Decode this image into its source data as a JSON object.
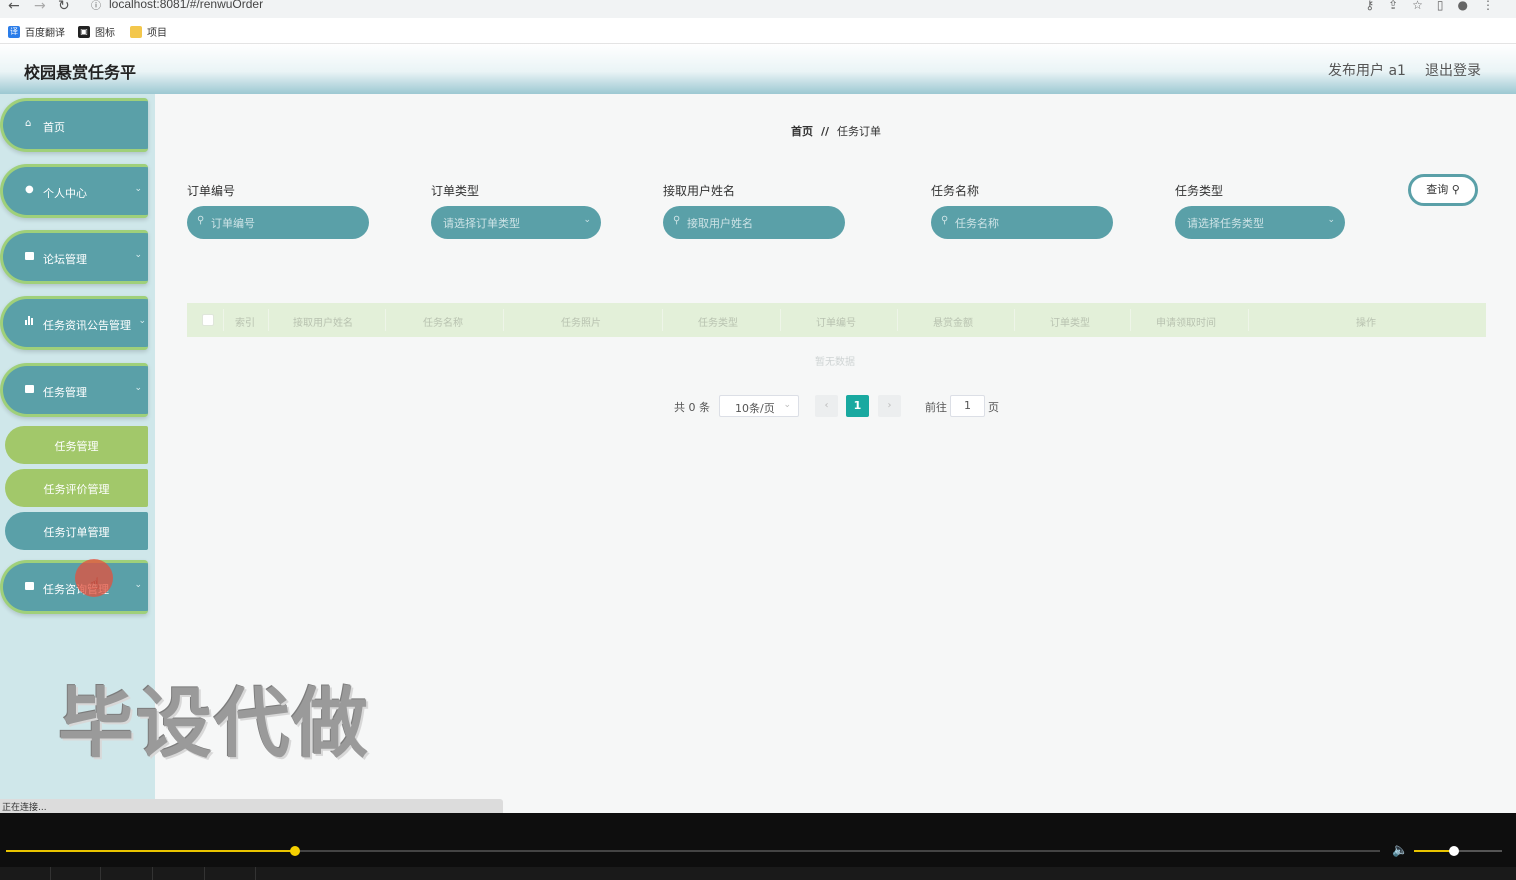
{
  "browser": {
    "url": "localhost:8081/#/renwuOrder",
    "bookmarks": [
      {
        "label": "百度翻译",
        "icon": "translate-icon"
      },
      {
        "label": "图标",
        "icon": "image-icon"
      },
      {
        "label": "项目",
        "icon": "folder-icon"
      }
    ],
    "status_text": "正在连接..."
  },
  "header": {
    "title": "校园悬赏任务平",
    "user_label": "发布用户 a1",
    "logout_label": "退出登录"
  },
  "sidebar": {
    "items": [
      {
        "label": "首页",
        "icon": "home-icon"
      },
      {
        "label": "个人中心",
        "icon": "user-icon"
      },
      {
        "label": "论坛管理",
        "icon": "forum-icon"
      },
      {
        "label": "任务资讯公告管理",
        "icon": "chart-icon"
      },
      {
        "label": "任务管理",
        "icon": "briefcase-icon"
      },
      {
        "label": "任务咨询管理",
        "icon": "chat-icon"
      }
    ],
    "sub_items": [
      {
        "label": "任务管理"
      },
      {
        "label": "任务评价管理"
      },
      {
        "label": "任务订单管理"
      }
    ]
  },
  "breadcrumb": {
    "home": "首页",
    "separator": "//",
    "current": "任务订单"
  },
  "search": {
    "fields": [
      {
        "label": "订单编号",
        "placeholder": "订单编号"
      },
      {
        "label": "订单类型",
        "placeholder": "请选择订单类型"
      },
      {
        "label": "接取用户姓名",
        "placeholder": "接取用户姓名"
      },
      {
        "label": "任务名称",
        "placeholder": "任务名称"
      },
      {
        "label": "任务类型",
        "placeholder": "请选择任务类型"
      }
    ],
    "query_label": "查询"
  },
  "table": {
    "columns": [
      "索引",
      "接取用户姓名",
      "任务名称",
      "任务照片",
      "任务类型",
      "订单编号",
      "悬赏金额",
      "订单类型",
      "申请领取时间",
      "操作"
    ],
    "empty_text": "暂无数据"
  },
  "pagination": {
    "total_text": "共 0 条",
    "page_size": "10条/页",
    "current_page": "1",
    "goto_label": "前往",
    "goto_value": "1",
    "page_unit": "页",
    "prev_icon": "‹",
    "next_icon": "›"
  },
  "watermark": "毕设代做",
  "player": {
    "progress": 0.21,
    "volume": 0.45
  }
}
